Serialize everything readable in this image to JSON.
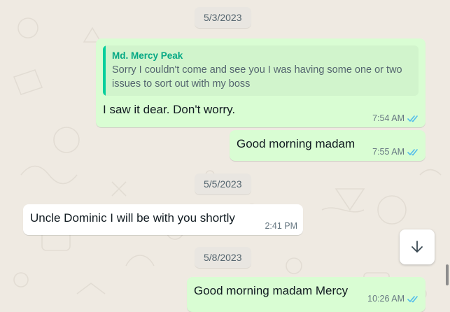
{
  "colors": {
    "wallpaper": "#efeae2",
    "outgoing_bubble": "#d9fdd3",
    "incoming_bubble": "#ffffff",
    "read_ticks": "#53bdeb",
    "quote_author": "#06a884"
  },
  "date_separators": [
    "5/3/2023",
    "5/5/2023",
    "5/8/2023"
  ],
  "messages": [
    {
      "direction": "outgoing",
      "quoted": {
        "author": "Md. Mercy Peak",
        "text": "Sorry I couldn't come and see you I was having some one or two issues to sort out with my boss"
      },
      "text": "I saw it dear. Don't worry.",
      "time": "7:54 AM",
      "status": "read"
    },
    {
      "direction": "outgoing",
      "text": "Good morning madam",
      "time": "7:55 AM",
      "status": "read"
    },
    {
      "direction": "incoming",
      "text": "Uncle Dominic I will be with you shortly",
      "time": "2:41 PM"
    },
    {
      "direction": "outgoing",
      "text": "Good morning madam Mercy",
      "time": "10:26 AM",
      "status": "read"
    }
  ],
  "controls": {
    "scroll_down_icon": "arrow-down-icon",
    "read_receipt_icon": "double-check-icon"
  }
}
